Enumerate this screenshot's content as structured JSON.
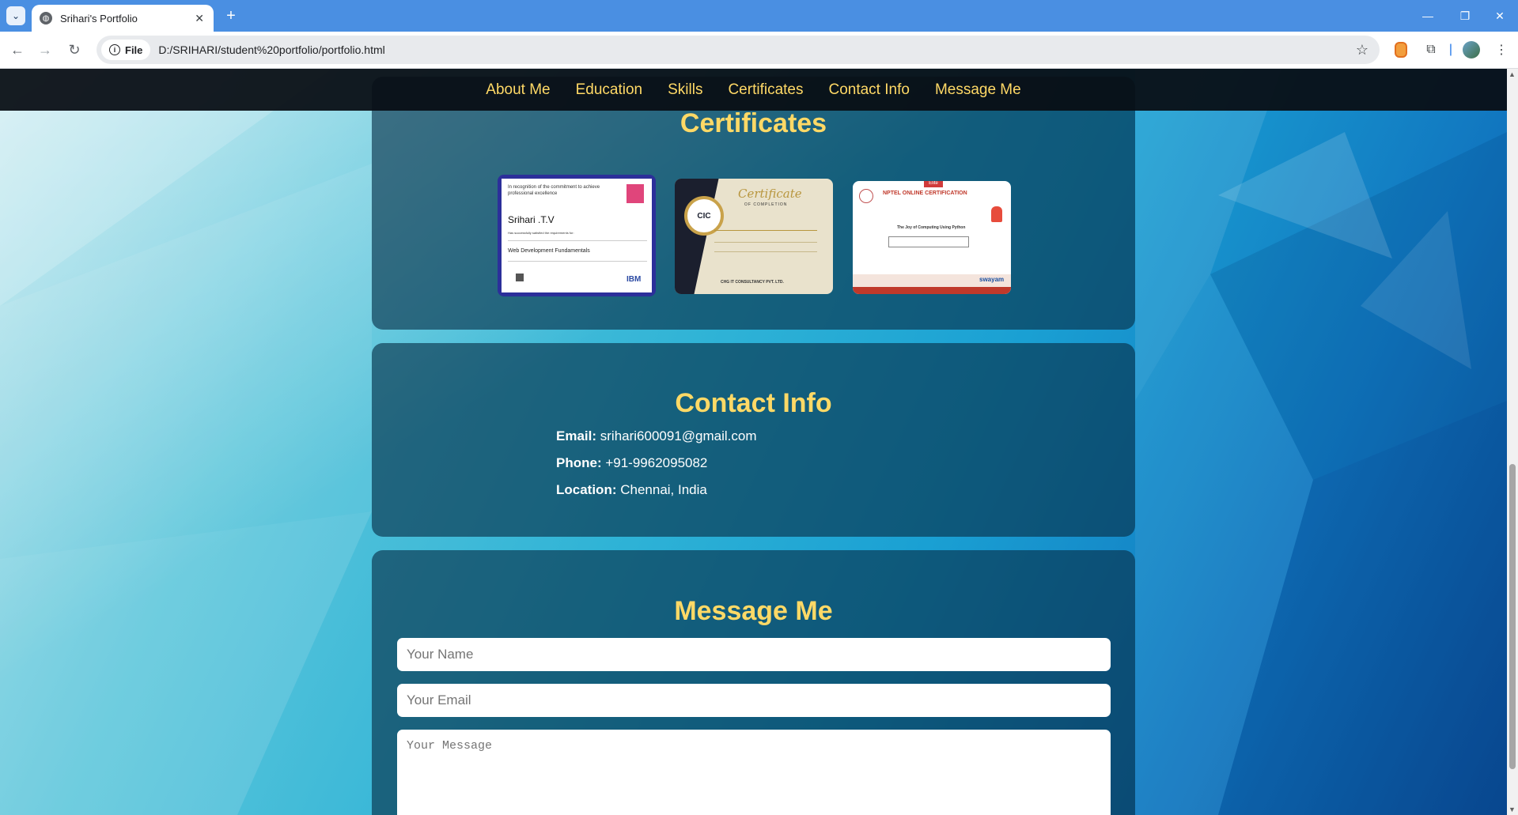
{
  "browser": {
    "tab_title": "Srihari's Portfolio",
    "tab_close": "✕",
    "new_tab": "+",
    "address_chip": "File",
    "url": "D:/SRIHARI/student%20portfolio/portfolio.html",
    "window_controls": [
      "—",
      "❐",
      "✕"
    ]
  },
  "nav": {
    "items": [
      "About Me",
      "Education",
      "Skills",
      "Certificates",
      "Contact Info",
      "Message Me"
    ]
  },
  "certificates": {
    "title": "Certificates",
    "cert1": {
      "line1": "In recognition of the commitment to achieve",
      "line2": "professional excellence",
      "name": "Srihari .T.V",
      "text": "Has successfully satisfied the requirements for:",
      "course": "Web Development Fundamentals",
      "brand": "IBM"
    },
    "cert2": {
      "title": "Certificate",
      "subtitle": "OF COMPLETION",
      "logo": "CIC",
      "footer": "CHG IT CONSULTANCY PVT. LTD."
    },
    "cert3": {
      "badge": "Elite",
      "title": "NPTEL ONLINE CERTIFICATION",
      "course": "The Joy of Computing Using Python",
      "brand": "swayam"
    }
  },
  "contact": {
    "title": "Contact Info",
    "email_label": "Email:",
    "email": "srihari600091@gmail.com",
    "phone_label": "Phone:",
    "phone": "+91-9962095082",
    "location_label": "Location:",
    "location": "Chennai, India"
  },
  "message": {
    "title": "Message Me",
    "name_placeholder": "Your Name",
    "email_placeholder": "Your Email",
    "message_placeholder": "Your Message"
  }
}
